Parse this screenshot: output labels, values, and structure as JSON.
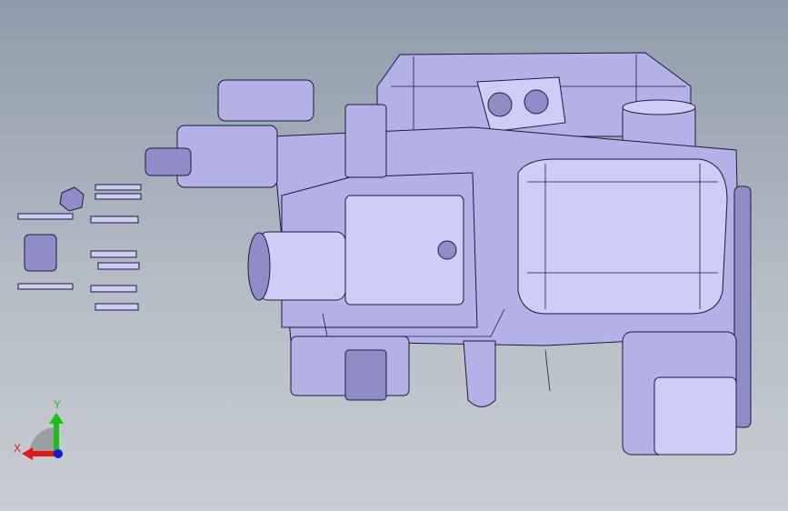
{
  "viewport": {
    "background_top": "#8e9cab",
    "background_bottom": "#c9cdd2",
    "model_color": "#b3b1e6"
  },
  "triad": {
    "x_label": "X",
    "y_label": "Y",
    "x_color": "#e01010",
    "y_color": "#10c010",
    "z_color": "#1010e0"
  }
}
